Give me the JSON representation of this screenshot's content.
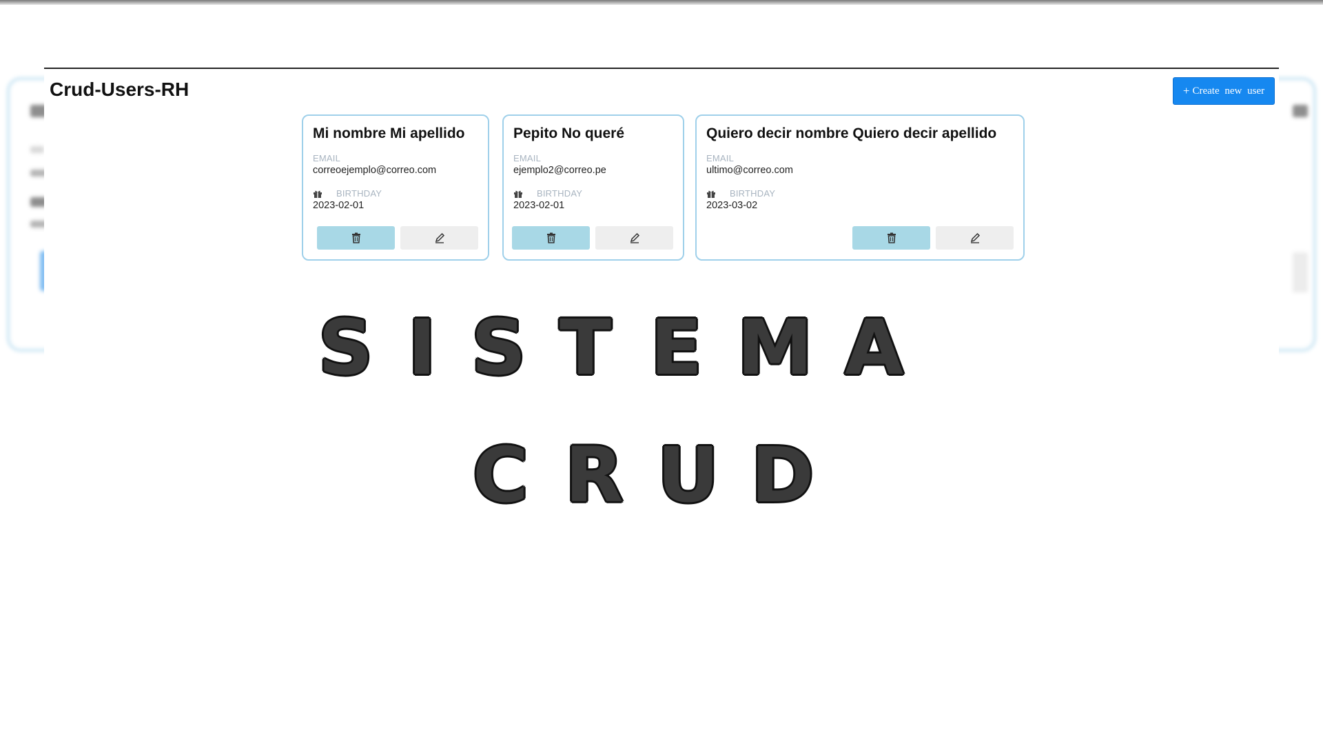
{
  "app": {
    "title": "Crud-Users-RH",
    "create_button": {
      "icon": "plus-icon",
      "plus": "+",
      "label": "Create new user"
    }
  },
  "users": [
    {
      "name": "Mi nombre Mi apellido",
      "email_label": "EMAIL",
      "email": "correoejemplo@correo.com",
      "birthday_label": "BIRTHDAY",
      "birthday": "2023-02-01"
    },
    {
      "name": "Pepito No queré",
      "email_label": "EMAIL",
      "email": "ejemplo2@correo.pe",
      "birthday_label": "BIRTHDAY",
      "birthday": "2023-02-01"
    },
    {
      "name": "Quiero decir nombre Quiero decir apellido",
      "email_label": "EMAIL",
      "email": "ultimo@correo.com",
      "birthday_label": "BIRTHDAY",
      "birthday": "2023-03-02"
    }
  ],
  "icons": {
    "delete": "trash-icon",
    "edit": "pencil-icon",
    "birthday": "gift-icon"
  },
  "colors": {
    "primary": "#1688f0",
    "card_border": "#9fd0ea",
    "delete_bg": "#a8d8e6",
    "edit_bg": "#eeeeee"
  },
  "overlay": {
    "line1": [
      "S",
      "I",
      "S",
      "T",
      "E",
      "M",
      "A"
    ],
    "line2": [
      "C",
      "R",
      "U",
      "D"
    ]
  }
}
